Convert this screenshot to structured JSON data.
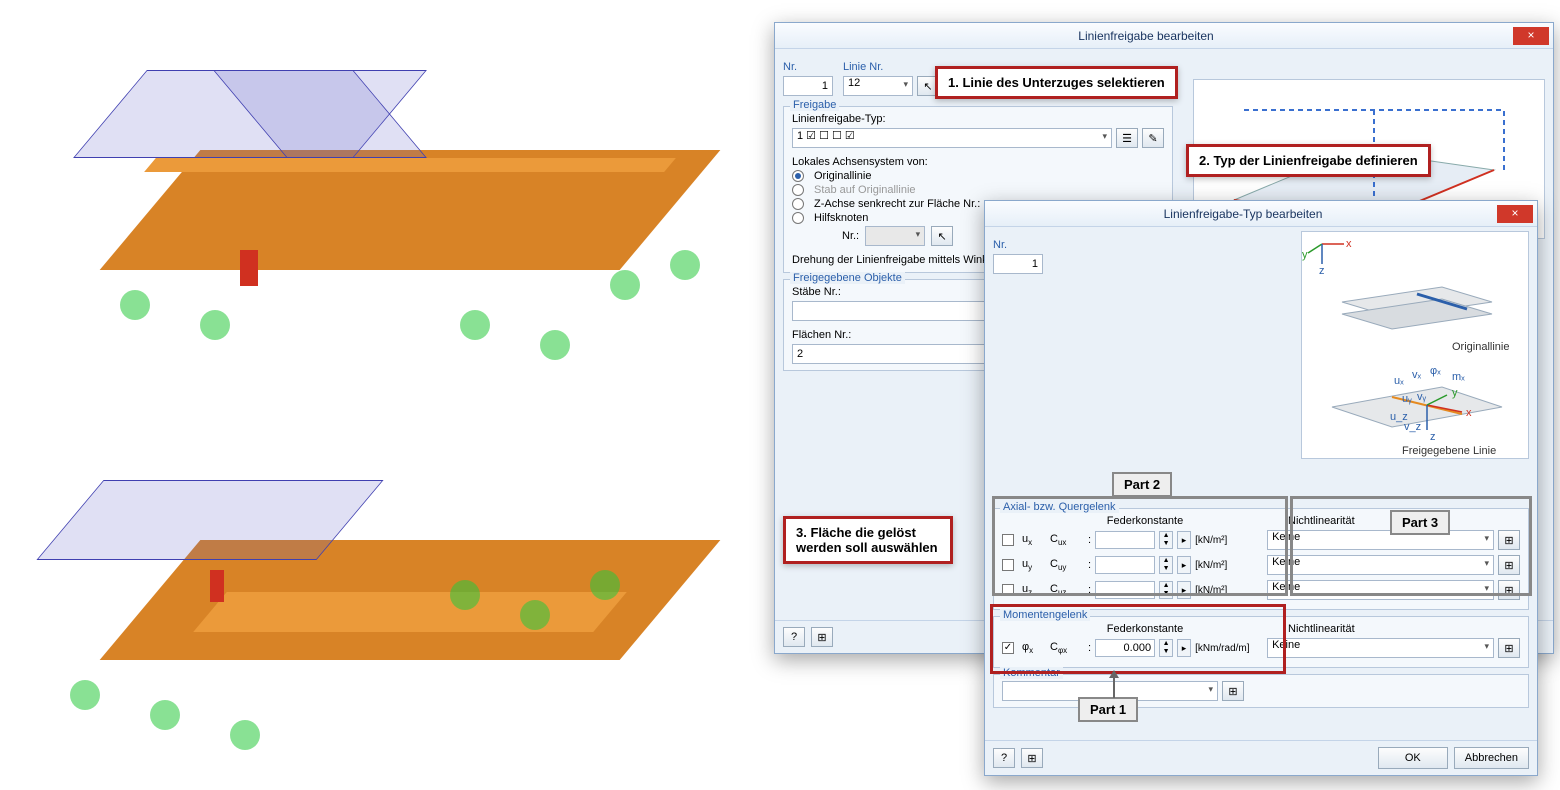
{
  "dialog1": {
    "title": "Linienfreigabe bearbeiten",
    "nr_label": "Nr.",
    "nr_value": "1",
    "linie_nr_label": "Linie Nr.",
    "linie_nr_value": "12",
    "freigabe_label": "Freigabe",
    "typ_label": "Linienfreigabe-Typ:",
    "typ_value": "1    ☑ ☐ ☐   ☑",
    "achsen_label": "Lokales Achsensystem von:",
    "radio_original": "Originallinie",
    "radio_stab": "Stab auf Originallinie",
    "radio_z": "Z-Achse senkrecht zur Fläche Nr.:",
    "radio_hilf": "Hilfsknoten",
    "nr_sub": "Nr.:",
    "drehung": "Drehung der Linienfreigabe mittels Winkel",
    "objekte_label": "Freigegebene Objekte",
    "staebe_label": "Stäbe Nr.:",
    "flaechen_label": "Flächen Nr.:",
    "flaechen_value": "2"
  },
  "dialog2": {
    "title": "Linienfreigabe-Typ bearbeiten",
    "nr_label": "Nr.",
    "nr_value": "1",
    "axial_label": "Axial- bzw. Quergelenk",
    "feder_header": "Federkonstante",
    "nonlin_header": "Nichtlinearität",
    "rows": [
      {
        "sym": "uₓ",
        "c": "Cᵤₓ",
        "colon": ":",
        "unit": "[kN/m²]",
        "nonlin": "Keine",
        "checked": false
      },
      {
        "sym": "uᵧ",
        "c": "Cᵤᵧ",
        "colon": ":",
        "unit": "[kN/m²]",
        "nonlin": "Keine",
        "checked": false
      },
      {
        "sym": "u_z",
        "c": "Cᵤ_z",
        "colon": ":",
        "unit": "[kN/m²]",
        "nonlin": "Keine",
        "checked": false
      }
    ],
    "moment_label": "Momentengelenk",
    "phi_sym": "φₓ",
    "phi_c": "Cφₓ",
    "phi_colon": ":",
    "phi_val": "0.000",
    "phi_unit": "[kNm/rad/m]",
    "phi_nonlin": "Keine",
    "kom_label": "Kommentar",
    "ok": "OK",
    "cancel": "Abbrechen",
    "diag": {
      "orig": "Originallinie",
      "frei": "Freigegebene Linie"
    }
  },
  "callouts": {
    "c1": "1. Linie des Unterzuges selektieren",
    "c2": "2. Typ der Linienfreigabe definieren",
    "c3": "3. Fläche die gelöst werden soll auswählen",
    "p1": "Part 1",
    "p2": "Part 2",
    "p3": "Part 3"
  }
}
